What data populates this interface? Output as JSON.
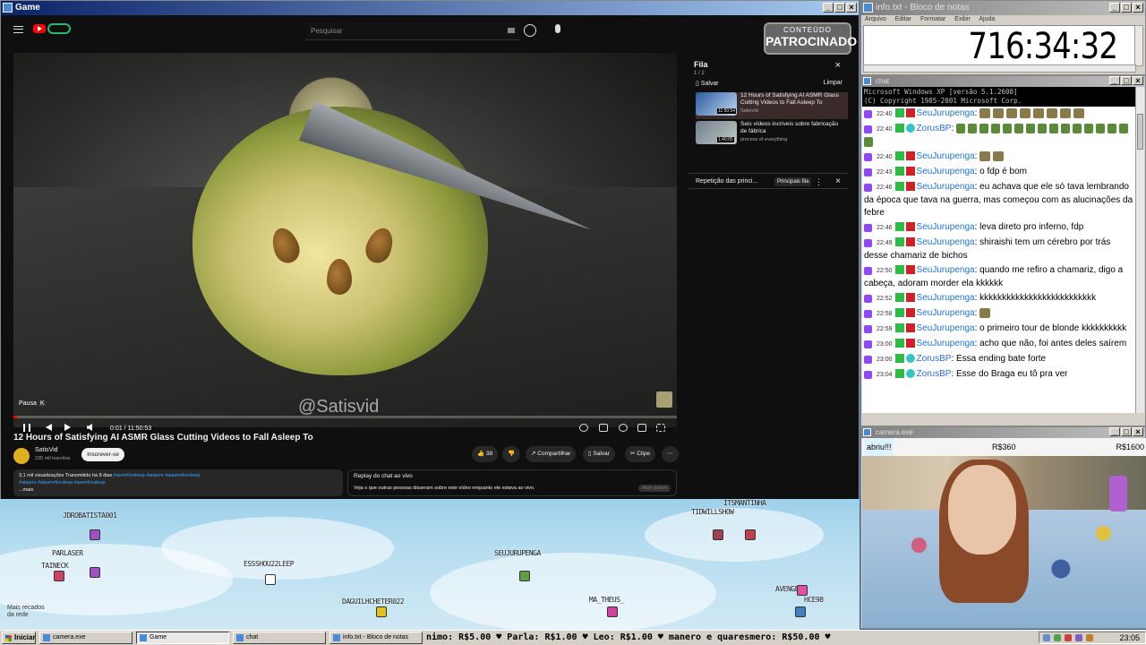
{
  "windows": {
    "game": {
      "title": "Game"
    },
    "notepad": {
      "title": "info.txt - Bloco de notas",
      "menu": [
        "Arquivo",
        "Editar",
        "Formatar",
        "Exibir",
        "Ajuda"
      ],
      "clock": "716:34:32"
    },
    "chat": {
      "title": "chat"
    },
    "camera": {
      "title": "camera.exe"
    }
  },
  "youtube": {
    "search_placeholder": "Pesquisar",
    "sponsor": {
      "line1": "CONTEÚDO",
      "line2": "PATROCINADO"
    },
    "watermark": "@Satisvid",
    "pause_tip": "Pausa",
    "pause_key": "K",
    "time": "0:01 / 11:50:53",
    "progress": 0.001,
    "video_title": "12 Hours of Satisfying AI ASMR Glass Cutting Videos to Fall Asleep To",
    "channel": {
      "name": "SatisVid",
      "subs": "235 mil inscritos",
      "subscribe": "Inscrever-se"
    },
    "actions": {
      "likes": "38",
      "share": "Compartilhar",
      "save": "Salvar",
      "clip": "Clipe"
    },
    "description": {
      "stats": "3,1 mil visualizações  Transmitido há 8 dias",
      "tags1": "#asmrforsleep #aiasmr #aiasmrforsleep",
      "tags2": "#aiasmr #aiasmrforsleep #asmrforsleep",
      "more": "...mais"
    },
    "chat_replay": {
      "title": "Replay do chat ao vivo",
      "text": "Veja o que outras pessoas disseram sobre este vídeo enquanto ele estava ao vivo.",
      "button": "Abrir painel"
    },
    "queue": {
      "title": "Fila",
      "count": "1 / 2",
      "save": "Salvar",
      "clear": "Limpar",
      "items": [
        {
          "title": "12 Hours of Satisfying AI ASMR Glass Cutting Videos to Fall Asleep To",
          "channel": "SatisVid",
          "duration": "11:50:54"
        },
        {
          "title": "Seis vídeos incríveis sobre fabricação de fábrica",
          "channel": "process of everything",
          "duration": "1:40:05"
        }
      ]
    },
    "replay_bar": {
      "label": "Repetição das princi...",
      "chip": "Principais fila"
    }
  },
  "game_players": [
    {
      "name": "JDROBATISTA001",
      "color": "#a050c0"
    },
    {
      "name": "PARLASER",
      "color": "#a050c0"
    },
    {
      "name": "TAINECK",
      "color": "#d04060"
    },
    {
      "name": "ESSSHOU22LEEP",
      "color": "#ffffff"
    },
    {
      "name": "SEUJURUPENGA",
      "color": "#60a040"
    },
    {
      "name": "DAGUILHCHETER022",
      "color": "#e0c020"
    },
    {
      "name": "MA_THEUS_",
      "color": "#d040a0"
    },
    {
      "name": "TIDWILLSHOW",
      "color": "#a04050"
    },
    {
      "name": "ITSMANTINHA",
      "color": "#c04050"
    },
    {
      "name": "AVENGER",
      "color": "#e050a0"
    },
    {
      "name": "HCE98",
      "color": "#4080c0"
    }
  ],
  "game_notice": "Mais recados da rede",
  "chat": {
    "cmd_line1": "Microsoft Windows XP [versão 5.1.2600]",
    "cmd_line2": "(C) Copyright 1985-2001 Microsoft Corp.",
    "messages": [
      {
        "time": "22:40",
        "user": "SeuJurupenga",
        "text": ""
      },
      {
        "time": "22:40",
        "user": "ZorusBP",
        "text": ""
      },
      {
        "time": "22:40",
        "user": "SeuJurupenga",
        "text": ""
      },
      {
        "time": "22:43",
        "user": "SeuJurupenga",
        "text": "o fdp é bom"
      },
      {
        "time": "22:46",
        "user": "SeuJurupenga",
        "text": "eu achava que ele só tava lembrando da época que tava na guerra, mas começou com as alucinações da febre"
      },
      {
        "time": "22:46",
        "user": "SeuJurupenga",
        "text": "leva direto pro inferno, fdp"
      },
      {
        "time": "22:49",
        "user": "SeuJurupenga",
        "text": "shiraishi tem um cérebro por trás desse chamariz de bichos"
      },
      {
        "time": "22:50",
        "user": "SeuJurupenga",
        "text": "quando me refiro a chamariz, digo a cabeça, adoram morder ela kkkkkk"
      },
      {
        "time": "22:52",
        "user": "SeuJurupenga",
        "text": "kkkkkkkkkkkkkkkkkkkkkkkkkk"
      },
      {
        "time": "22:58",
        "user": "SeuJurupenga",
        "text": ""
      },
      {
        "time": "22:59",
        "user": "SeuJurupenga",
        "text": "o primeiro tour de blonde kkkkkkkkkk"
      },
      {
        "time": "23:00",
        "user": "SeuJurupenga",
        "text": "acho que não, foi antes deles saírem"
      },
      {
        "time": "23:00",
        "user": "ZorusBP",
        "text": "Essa ending bate forte"
      },
      {
        "time": "23:04",
        "user": "ZorusBP",
        "text": "Esse do Braga eu tô pra ver"
      }
    ],
    "overlay_tag": "HERO_MP3"
  },
  "camera": {
    "h1": "abriu!!!",
    "h2": "R$360",
    "h3": "R$1600"
  },
  "taskbar": {
    "start": "Iniciar",
    "buttons": [
      "camera.exe",
      "Game",
      "chat",
      "info.txt - Bloco de notas"
    ],
    "ticker": "nimo: R$5.00  ♥ Parla: R$1.00  ♥ Leo: R$1.00  ♥ manero e quaresmero: R$50.00  ♥",
    "clock": "23:05"
  }
}
